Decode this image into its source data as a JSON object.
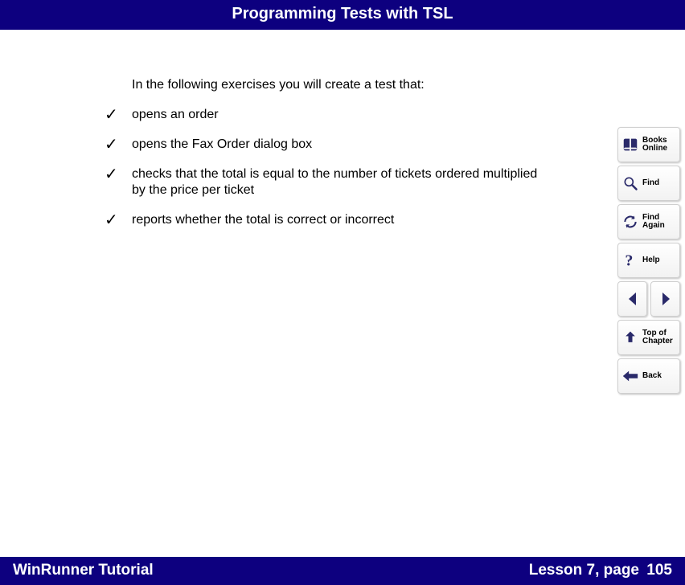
{
  "header": {
    "title": "Programming Tests with TSL"
  },
  "content": {
    "intro": "In the following exercises you will create a test that:",
    "items": [
      "opens an order",
      "opens the Fax Order dialog box",
      "checks that the total is equal to the number of tickets ordered multiplied by the price per ticket",
      "reports whether the total is correct or incorrect"
    ]
  },
  "sidebar": {
    "books_online": "Books Online",
    "find": "Find",
    "find_again": "Find Again",
    "help": "Help",
    "top_of_chapter": "Top of Chapter",
    "back": "Back"
  },
  "footer": {
    "left": "WinRunner Tutorial",
    "lesson": "Lesson 7, page",
    "page": "105"
  }
}
